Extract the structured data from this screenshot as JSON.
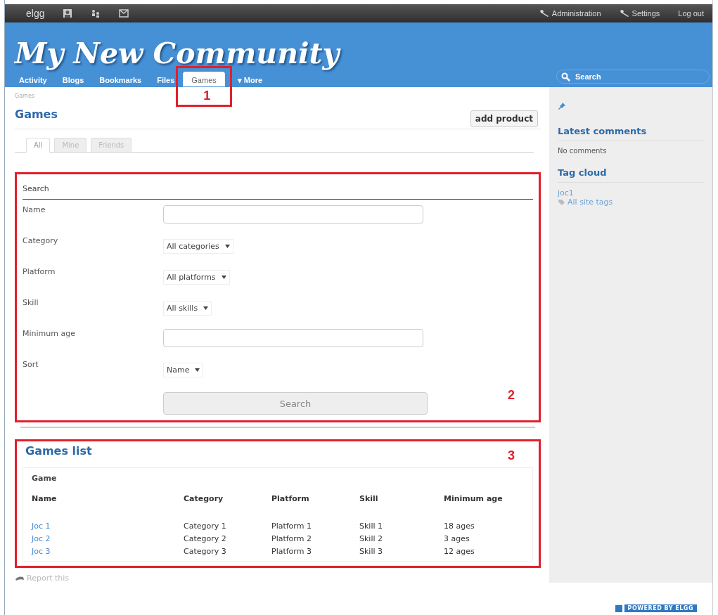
{
  "top_bar": {
    "logo": "elgg",
    "links": [
      {
        "kind": "tool",
        "label": "Administration"
      },
      {
        "kind": "tool",
        "label": "Settings"
      },
      {
        "kind": "plain",
        "label": "Log out"
      }
    ]
  },
  "header": {
    "title": "My New Community",
    "search": {
      "placeholder": "Search"
    }
  },
  "nav": [
    {
      "label": "Activity",
      "selected": false
    },
    {
      "label": "Blogs",
      "selected": false
    },
    {
      "label": "Bookmarks",
      "selected": false
    },
    {
      "label": "Files",
      "selected": false
    },
    {
      "label": "Games",
      "selected": true
    },
    {
      "label": "▾ More",
      "selected": false
    }
  ],
  "annotations": [
    {
      "kind": "nav",
      "label": "1"
    },
    {
      "kind": "search_form",
      "label": "2"
    },
    {
      "kind": "games_list",
      "label": "3"
    }
  ],
  "breadcrumb": "Games",
  "page_title": "Games",
  "add_button": "add product",
  "filter_tabs": [
    {
      "label": "All",
      "selected": true
    },
    {
      "label": "Mine",
      "selected": false
    },
    {
      "label": "Friends",
      "selected": false
    }
  ],
  "search_form": {
    "title": "Search",
    "fields": [
      {
        "kind": "text",
        "label": "Name"
      },
      {
        "kind": "select",
        "label": "Category",
        "value": "All categories"
      },
      {
        "kind": "select",
        "label": "Platform",
        "value": "All platforms"
      },
      {
        "kind": "select",
        "label": "Skill",
        "value": "All skills"
      },
      {
        "kind": "text",
        "label": "Minimum age"
      },
      {
        "kind": "select",
        "label": "Sort",
        "value": "Name"
      }
    ],
    "submit": "Search"
  },
  "games_list": {
    "title": "Games list",
    "caption": "Game",
    "columns": [
      "Name",
      "Category",
      "Platform",
      "Skill",
      "Minimum age"
    ],
    "rows": [
      [
        "Joc 1",
        "Category 1",
        "Platform 1",
        "Skill 1",
        "18 ages"
      ],
      [
        "Joc 2",
        "Category 2",
        "Platform 2",
        "Skill 2",
        "3 ages"
      ],
      [
        "Joc 3",
        "Category 3",
        "Platform 3",
        "Skill 3",
        "12 ages"
      ]
    ]
  },
  "report": "Report this",
  "sidebar": {
    "sections": [
      {
        "title": "Latest comments",
        "items": [
          {
            "kind": "text",
            "label": "No comments"
          }
        ]
      },
      {
        "title": "Tag cloud",
        "items": [
          {
            "kind": "link",
            "label": "joc1"
          },
          {
            "kind": "tag_link",
            "label": "All site tags"
          }
        ]
      }
    ]
  },
  "footer": {
    "badge": "POWERED BY ELGG"
  }
}
